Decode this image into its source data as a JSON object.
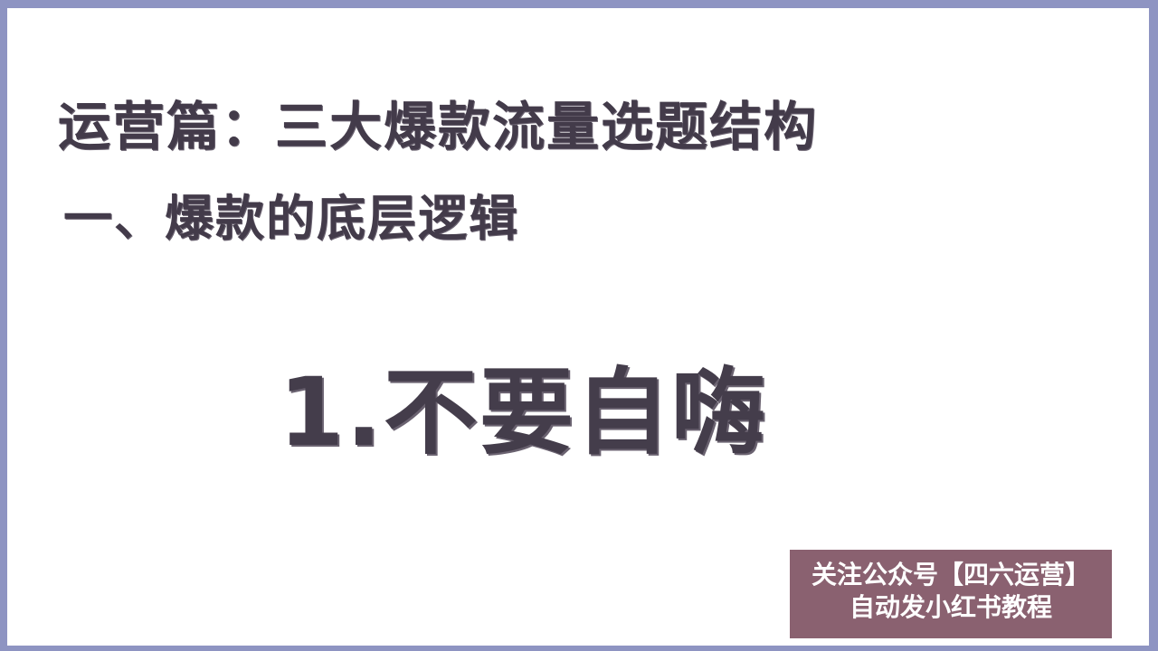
{
  "slide": {
    "title": "运营篇：三大爆款流量选题结构",
    "subtitle": "一、爆款的底层逻辑",
    "point": "1.不要自嗨"
  },
  "watermark": {
    "line1": "关注公众号【四六运营】",
    "line2": "自动发小红书教程"
  },
  "colors": {
    "frame": "#8e94c2",
    "slide_background": "#ffffff",
    "text": "#433b4a",
    "watermark_background": "#8a6170",
    "watermark_text": "#ffffff"
  }
}
